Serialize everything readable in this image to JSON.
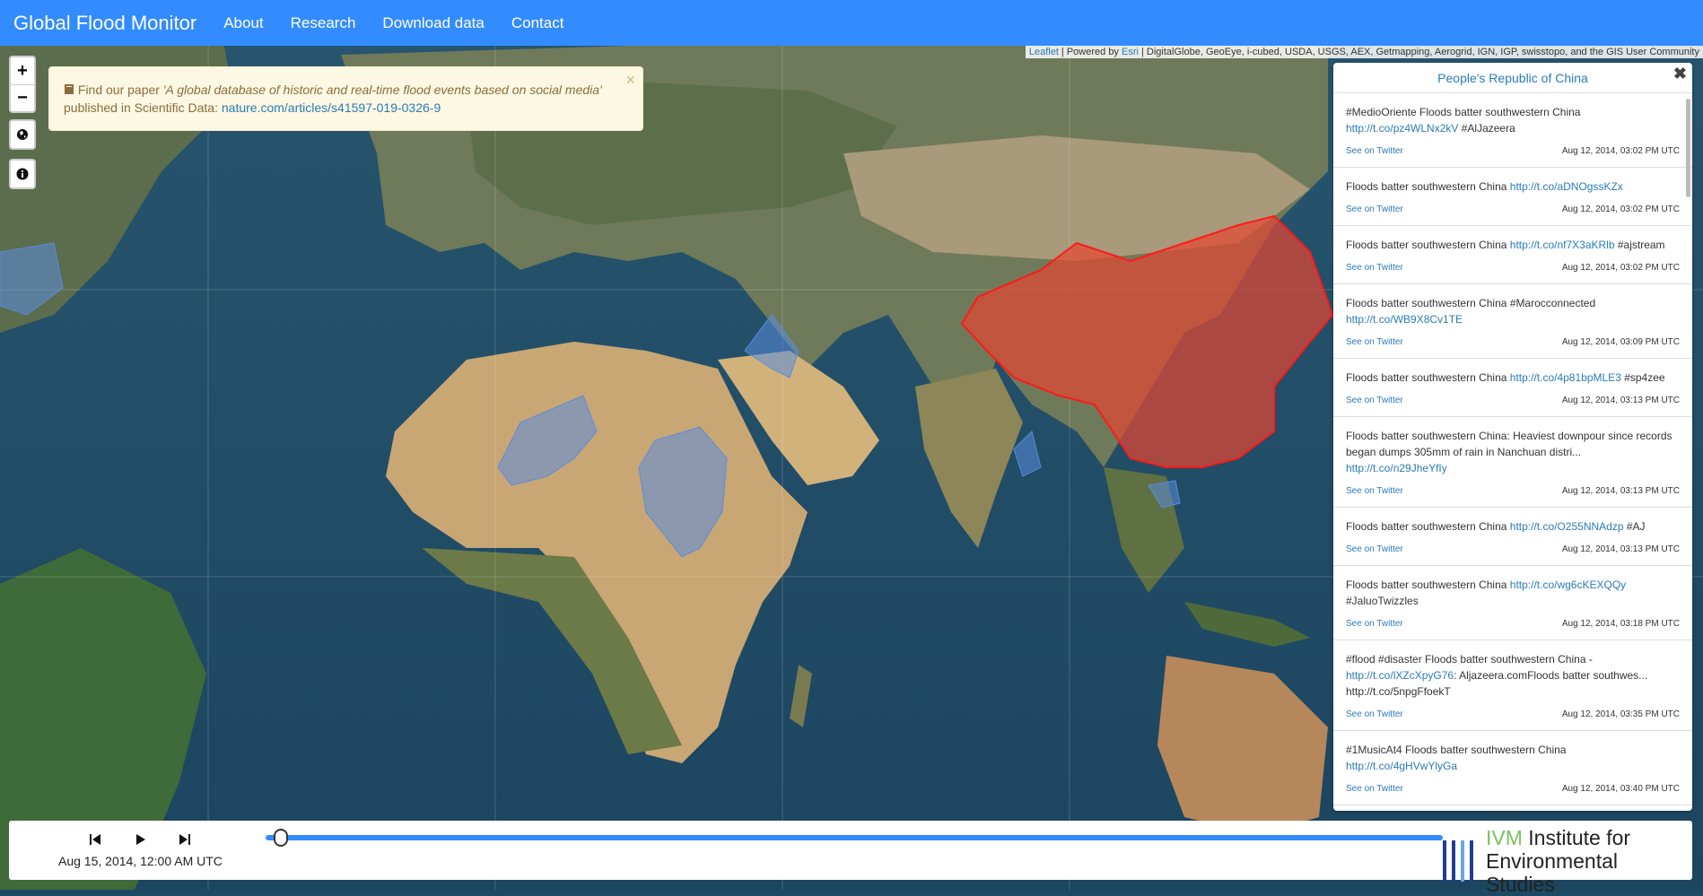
{
  "navbar": {
    "brand": "Global Flood Monitor",
    "links": [
      "About",
      "Research",
      "Download data",
      "Contact"
    ]
  },
  "attribution": {
    "leaflet": "Leaflet",
    "powered": " | Powered by ",
    "esri": "Esri",
    "rest": " | DigitalGlobe, GeoEye, i-cubed, USDA, USGS, AEX, Getmapping, Aerogrid, IGN, IGP, swisstopo, and the GIS User Community"
  },
  "controls": {
    "zoom_in": "+",
    "zoom_out": "−",
    "globe_icon": "globe-icon",
    "info_icon": "info-icon"
  },
  "alert": {
    "prefix": " Find our paper ",
    "title": "'A global database of historic and real-time flood events based on social media'",
    "middle": "published in Scientific Data: ",
    "link": "nature.com/articles/s41597-019-0326-9",
    "close": "×"
  },
  "panel": {
    "title": "People's Republic of China",
    "close": "✖",
    "tweets": [
      {
        "text": "#MedioOriente Floods batter southwestern China ",
        "link": "http://t.co/pz4WLNx2kV",
        "tail": " #AlJazeera",
        "see": "See on Twitter",
        "time": "Aug 12, 2014, 03:02 PM UTC"
      },
      {
        "text": "Floods batter southwestern China ",
        "link": "http://t.co/aDNOgssKZx",
        "tail": "",
        "see": "See on Twitter",
        "time": "Aug 12, 2014, 03:02 PM UTC"
      },
      {
        "text": "Floods batter southwestern China ",
        "link": "http://t.co/nf7X3aKRlb",
        "tail": " #ajstream",
        "see": "See on Twitter",
        "time": "Aug 12, 2014, 03:02 PM UTC"
      },
      {
        "text": "Floods batter southwestern China #Marocconnected ",
        "link": "http://t.co/WB9X8Cv1TE",
        "tail": "",
        "see": "See on Twitter",
        "time": "Aug 12, 2014, 03:09 PM UTC"
      },
      {
        "text": "Floods batter southwestern China ",
        "link": "http://t.co/4p81bpMLE3",
        "tail": " #sp4zee",
        "see": "See on Twitter",
        "time": "Aug 12, 2014, 03:13 PM UTC"
      },
      {
        "text": "Floods batter southwestern China: Heaviest downpour since records began dumps 305mm of rain in Nanchuan distri... ",
        "link": "http://t.co/n29JheYfIy",
        "tail": "",
        "see": "See on Twitter",
        "time": "Aug 12, 2014, 03:13 PM UTC"
      },
      {
        "text": "Floods batter southwestern China ",
        "link": "http://t.co/O255NNAdzp",
        "tail": " #AJ",
        "see": "See on Twitter",
        "time": "Aug 12, 2014, 03:13 PM UTC"
      },
      {
        "text": "Floods batter southwestern China ",
        "link": "http://t.co/wg6cKEXQQy",
        "tail": " #JaluoTwizzles",
        "see": "See on Twitter",
        "time": "Aug 12, 2014, 03:18 PM UTC"
      },
      {
        "text": "#flood #disaster Floods batter southwestern China - ",
        "link": "http://t.co/lXZcXpyG76",
        "tail": ": Aljazeera.comFloods batter southwes... http://t.co/5npgFfoekT",
        "see": "See on Twitter",
        "time": "Aug 12, 2014, 03:35 PM UTC"
      },
      {
        "text": "#1MusicAt4 Floods batter southwestern China ",
        "link": "http://t.co/4gHVwYlyGa",
        "tail": "",
        "see": "See on Twitter",
        "time": "Aug 12, 2014, 03:40 PM UTC"
      }
    ]
  },
  "timebar": {
    "date": "Aug 15, 2014, 12:00 AM UTC",
    "progress": 0.01,
    "logo_ivm": "IVM",
    "logo_line1": " Institute for",
    "logo_line2": "Environmental Studies",
    "logo_bar_colors": [
      "#1f3f8f",
      "#1f3f8f",
      "#6aa7e0",
      "#1f3f8f"
    ]
  }
}
